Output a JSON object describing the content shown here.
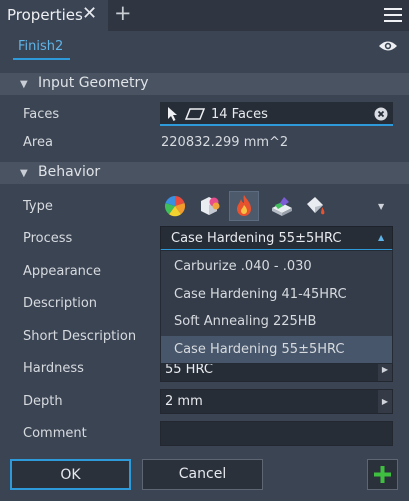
{
  "tab": {
    "title": "Properties"
  },
  "finish": {
    "name": "Finish2"
  },
  "input_geometry": {
    "title": "Input Geometry",
    "faces_label": "Faces",
    "faces_value": "14 Faces",
    "area_label": "Area",
    "area_value": "220832.299 mm^2"
  },
  "behavior": {
    "title": "Behavior",
    "type_label": "Type",
    "type_icons": [
      "color-wheel-icon",
      "cube-appearance-icon",
      "flame-icon",
      "paint-brush-icon",
      "paint-bucket-icon"
    ],
    "process_label": "Process",
    "process_value": "Case Hardening 55±5HRC",
    "process_options": [
      "Carburize .040 - .030",
      "Case Hardening 41-45HRC",
      "Soft Annealing 225HB",
      "Case Hardening 55±5HRC"
    ],
    "process_selected_index": 3,
    "appearance_label": "Appearance",
    "description_label": "Description",
    "short_description_label": "Short Description",
    "hardness_label": "Hardness",
    "hardness_value": "55 HRC",
    "depth_label": "Depth",
    "depth_value": "2 mm",
    "comment_label": "Comment"
  },
  "buttons": {
    "ok": "OK",
    "cancel": "Cancel"
  },
  "colors": {
    "accent": "#2f9ad9",
    "link": "#5fb4e8",
    "add_button": "#3fbf3f",
    "selected_type_bg": "#4d5a6c"
  }
}
